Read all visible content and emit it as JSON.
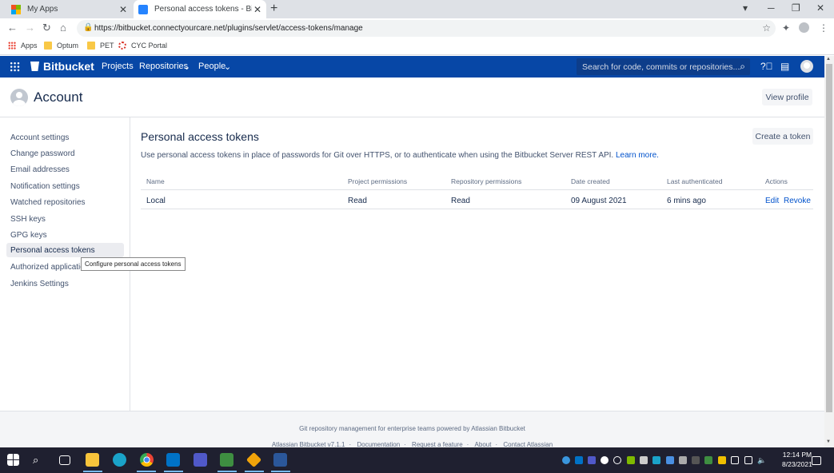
{
  "browser": {
    "tabs": [
      {
        "title": "My Apps",
        "active": false
      },
      {
        "title": "Personal access tokens - Bitbucket",
        "active": true
      }
    ],
    "new_tab": "+",
    "url": "https://bitbucket.connectyourcare.net/plugins/servlet/access-tokens/manage",
    "bookmarks": [
      "Apps",
      "Optum",
      "PET",
      "CYC Portal"
    ]
  },
  "header": {
    "brand": "Bitbucket",
    "nav": [
      "Projects",
      "Repositories",
      "People"
    ],
    "search_placeholder": "Search for code, commits or repositories..."
  },
  "account": {
    "title": "Account",
    "view_profile": "View profile"
  },
  "sidebar": {
    "items": [
      {
        "label": "Account settings"
      },
      {
        "label": "Change password"
      },
      {
        "label": "Email addresses"
      },
      {
        "label": "Notification settings"
      },
      {
        "label": "Watched repositories"
      },
      {
        "label": "SSH keys"
      },
      {
        "label": "GPG keys"
      },
      {
        "label": "Personal access tokens",
        "selected": true
      },
      {
        "label": "Authorized applications"
      },
      {
        "label": "Jenkins Settings"
      }
    ],
    "tooltip": "Configure personal access tokens"
  },
  "main": {
    "title": "Personal access tokens",
    "create_button": "Create a token",
    "description": "Use personal access tokens in place of passwords for Git over HTTPS, or to authenticate when using the Bitbucket Server REST API.",
    "learn_more": "Learn more.",
    "columns": [
      "Name",
      "Project permissions",
      "Repository permissions",
      "Date created",
      "Last authenticated",
      "Actions"
    ],
    "rows": [
      {
        "name": "Local",
        "project": "Read",
        "repository": "Read",
        "created": "09 August 2021",
        "last_auth": "6 mins ago",
        "edit": "Edit",
        "revoke": "Revoke"
      }
    ]
  },
  "footer": {
    "tagline": "Git repository management for enterprise teams powered by Atlassian Bitbucket",
    "version": "Atlassian Bitbucket v7.1.1",
    "links": [
      "Documentation",
      "Request a feature",
      "About",
      "Contact Atlassian"
    ]
  },
  "taskbar": {
    "time": "12:14 PM",
    "date": "8/23/2021"
  },
  "colors": {
    "header_bg": "#0747a6",
    "link": "#0052cc",
    "taskbar_bg": "#1f2030"
  }
}
